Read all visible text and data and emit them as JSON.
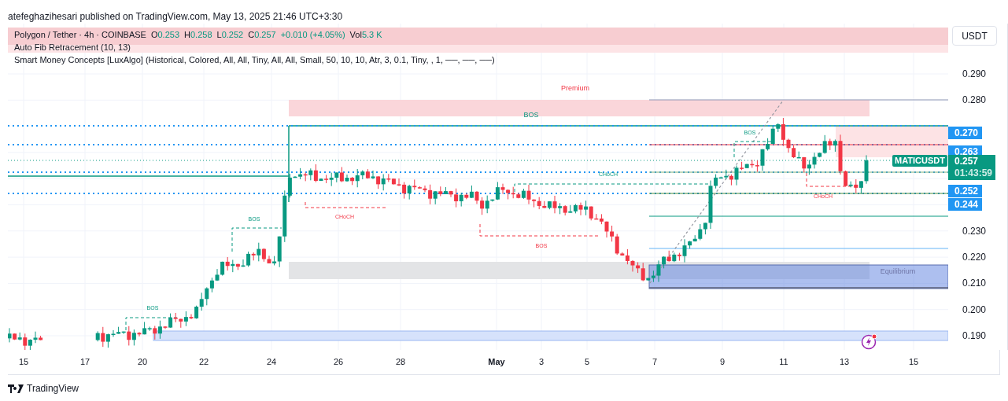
{
  "publisher_line": "atefeghazihesari published on TradingView.com, May 13, 2025 21:46 UTC+3:30",
  "legend": {
    "symbol": "Polygon / Tether · 4h · COINBASE",
    "ohlc": [
      {
        "label": "O",
        "value": "0.253"
      },
      {
        "label": "H",
        "value": "0.258"
      },
      {
        "label": "L",
        "value": "0.252"
      },
      {
        "label": "C",
        "value": "0.257"
      }
    ],
    "change": "+0.010 (+4.05%)",
    "volume_label": "Vol",
    "volume": "5.3 K",
    "indicators": [
      "Auto Fib Retracement (10, 13)",
      "Smart Money Concepts [LuxAlgo] (Historical, Colored, All, All, Tiny, All, All, Small, 50, 10, 10, Atr, 3, 0.1, Tiny, , 1, ──, ──, ──)"
    ]
  },
  "annotations": [
    {
      "text": "Premium",
      "kind": "bearish"
    },
    {
      "text": "BOS",
      "kind": "bullish"
    },
    {
      "text": "BOS",
      "kind": "bullish"
    },
    {
      "text": "CHoCH",
      "kind": "bullish"
    },
    {
      "text": "CHoCH",
      "kind": "bearish"
    },
    {
      "text": "BOS",
      "kind": "bullish"
    },
    {
      "text": "BOS",
      "kind": "bearish"
    },
    {
      "text": "CHoCH",
      "kind": "bearish"
    },
    {
      "text": "Equilibrium",
      "kind": "neutral"
    },
    {
      "text": "BOS",
      "kind": "bullish"
    }
  ],
  "currency_button": "USDT",
  "price_axis": [
    "0.290",
    "0.280",
    "0.230",
    "0.220",
    "0.210",
    "0.200",
    "0.190"
  ],
  "symbol_tag": "MATICUSDT",
  "price_tags": [
    {
      "kind": "level",
      "text": "0.270"
    },
    {
      "kind": "level",
      "text": "0.263"
    },
    {
      "kind": "last",
      "text": "0.257",
      "countdown": "01:43:59"
    },
    {
      "kind": "level",
      "text": "0.252"
    },
    {
      "kind": "level",
      "text": "0.244"
    }
  ],
  "time_axis": [
    {
      "text": "15",
      "bold": false
    },
    {
      "text": "17",
      "bold": false
    },
    {
      "text": "20",
      "bold": false
    },
    {
      "text": "22",
      "bold": false
    },
    {
      "text": "24",
      "bold": false
    },
    {
      "text": "26",
      "bold": false
    },
    {
      "text": "28",
      "bold": false
    },
    {
      "text": "May",
      "bold": true
    },
    {
      "text": "3",
      "bold": false
    },
    {
      "text": "5",
      "bold": false
    },
    {
      "text": "7",
      "bold": false
    },
    {
      "text": "9",
      "bold": false
    },
    {
      "text": "11",
      "bold": false
    },
    {
      "text": "13",
      "bold": false
    },
    {
      "text": "15",
      "bold": false
    }
  ],
  "footer_brand": "TradingView"
}
